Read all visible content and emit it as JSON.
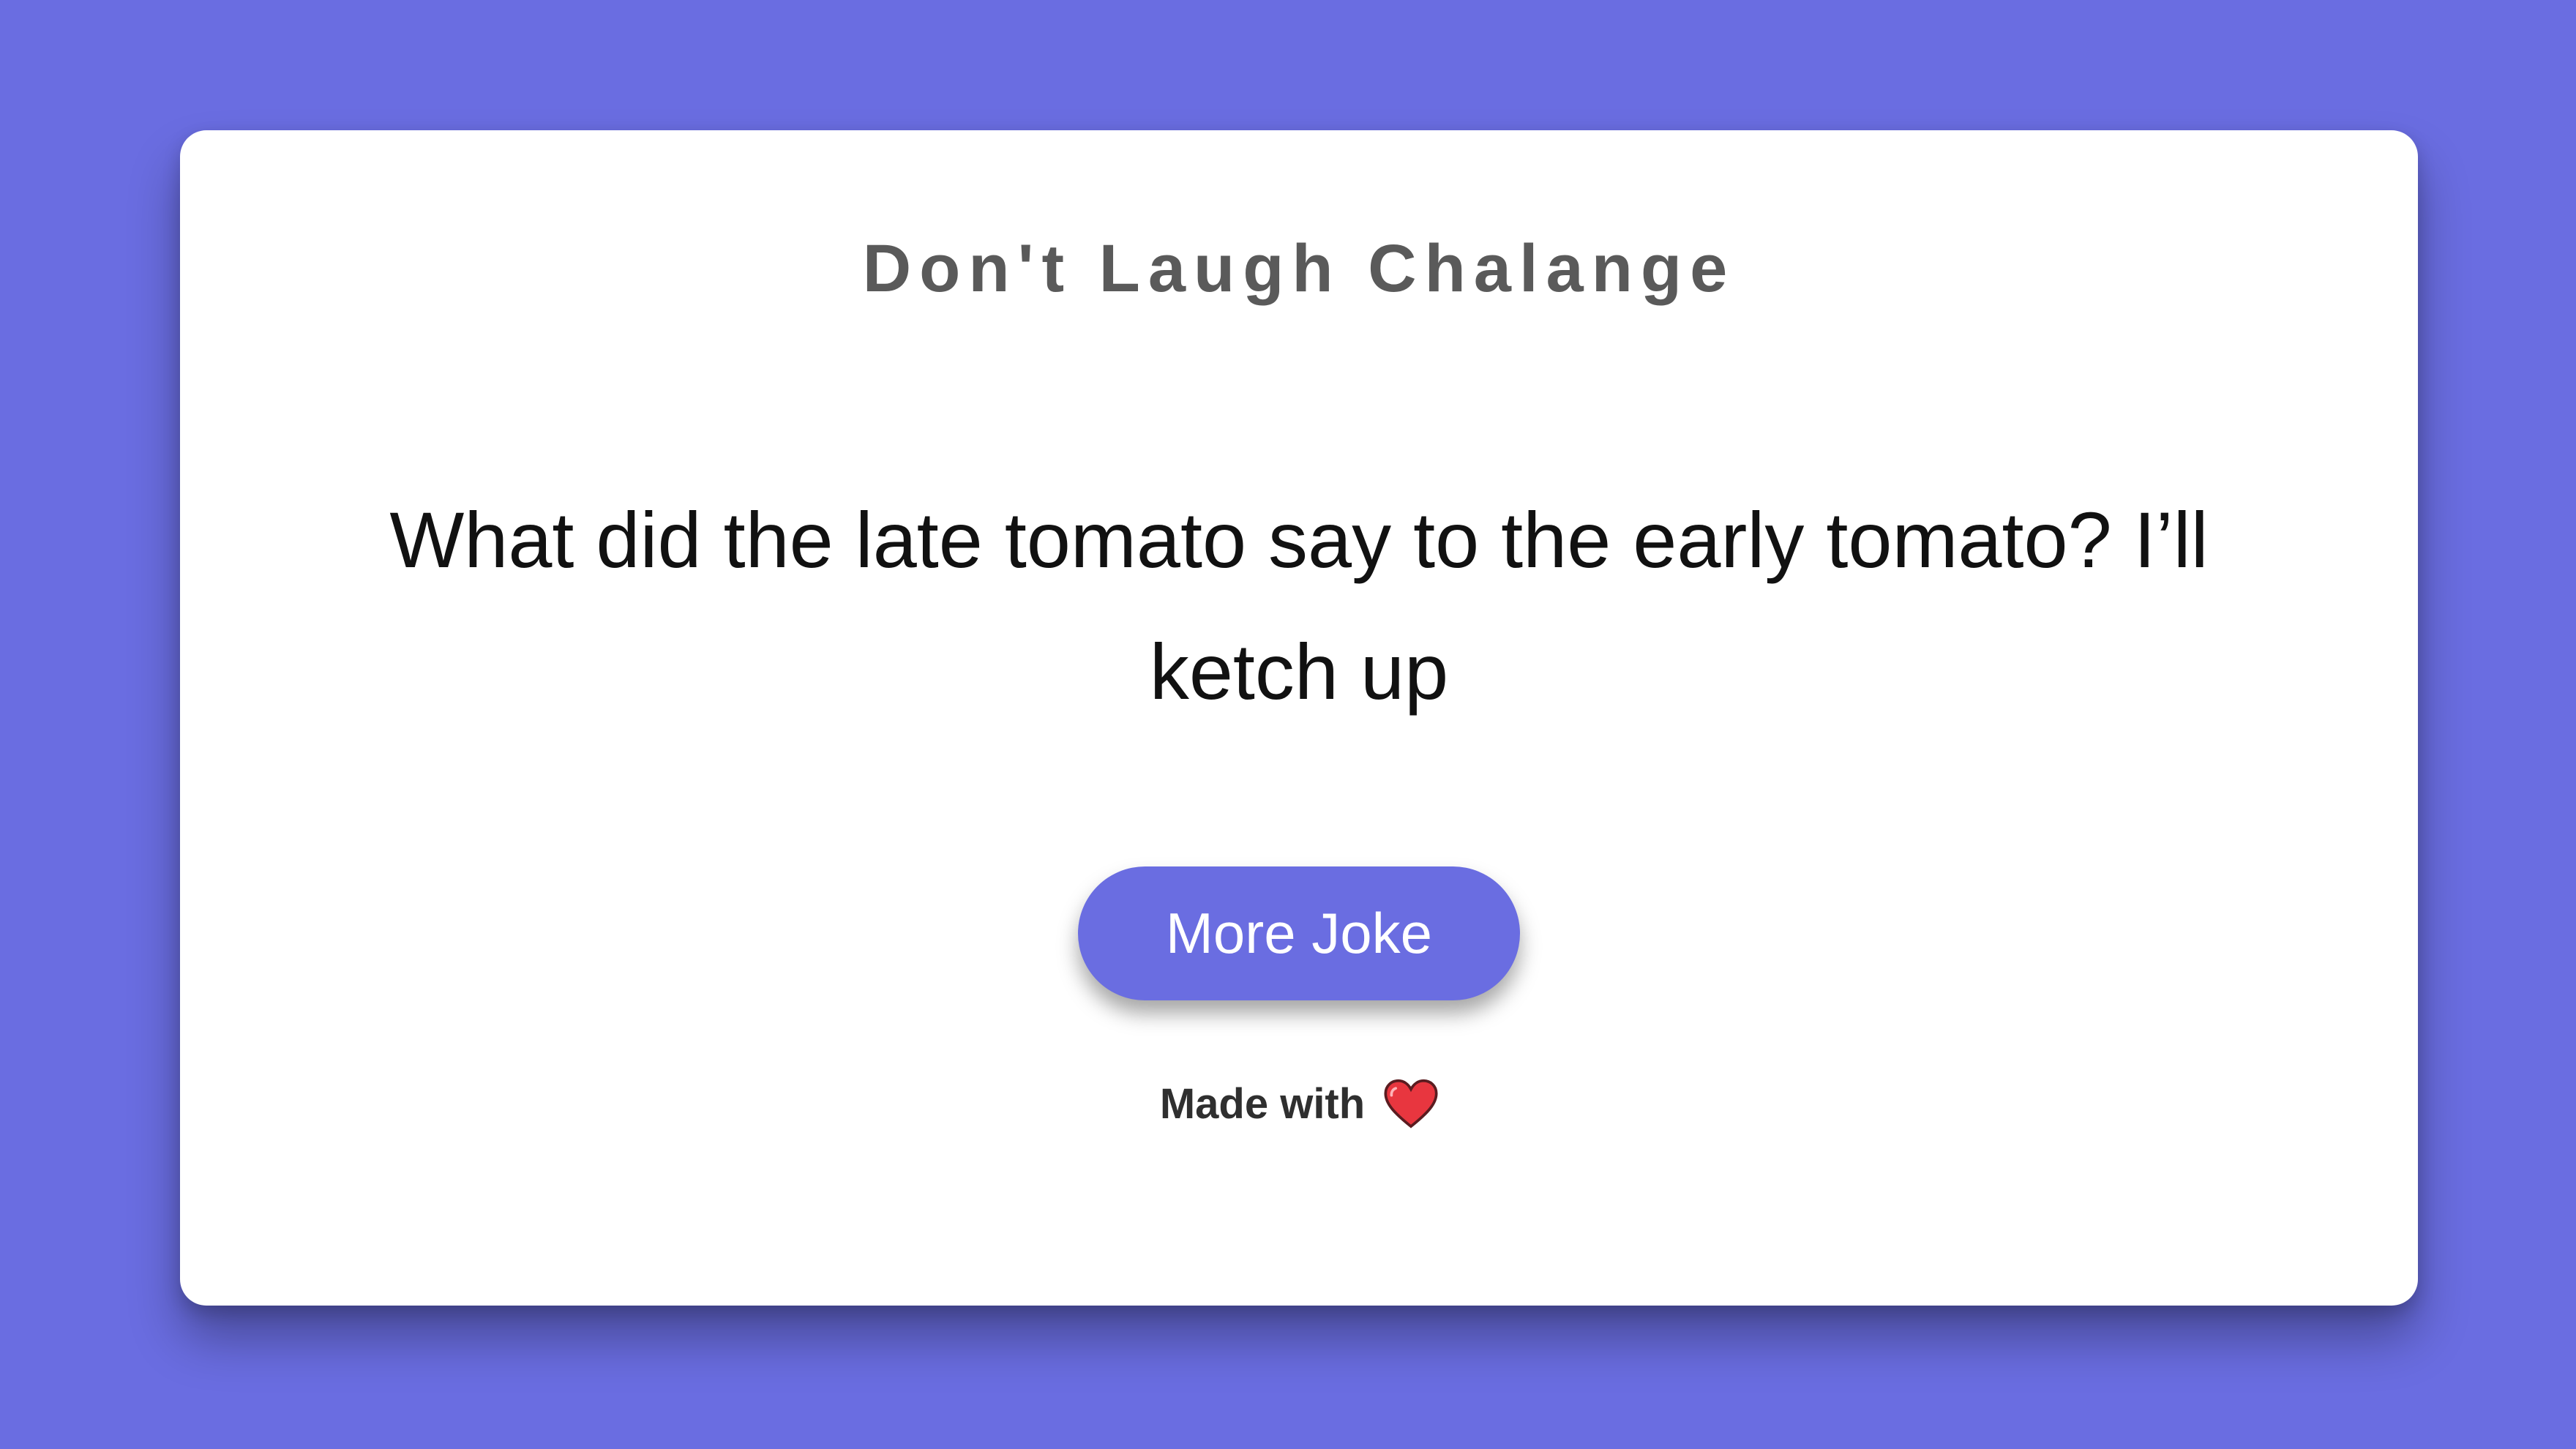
{
  "colors": {
    "background": "#6a6de1",
    "card": "#ffffff",
    "button": "#6a6de1",
    "heart": "#e8363f"
  },
  "card": {
    "title": "Don't Laugh Chalange",
    "joke": "What did the late tomato say to the early tomato? I’ll ketch up",
    "button_label": "More Joke",
    "footer_text": "Made with",
    "footer_icon": "heart-icon"
  }
}
